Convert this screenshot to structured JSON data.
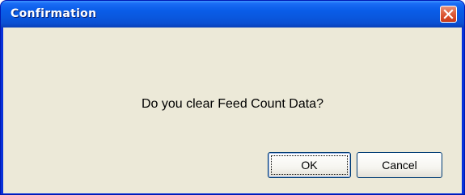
{
  "window": {
    "title": "Confirmation"
  },
  "dialog": {
    "message": "Do you clear Feed Count Data?",
    "ok_label": "OK",
    "cancel_label": "Cancel"
  },
  "icons": {
    "close": "close-icon"
  },
  "colors": {
    "titlebar": "#0a5de8",
    "client_background": "#ece9d8",
    "close_button": "#d84a25"
  }
}
